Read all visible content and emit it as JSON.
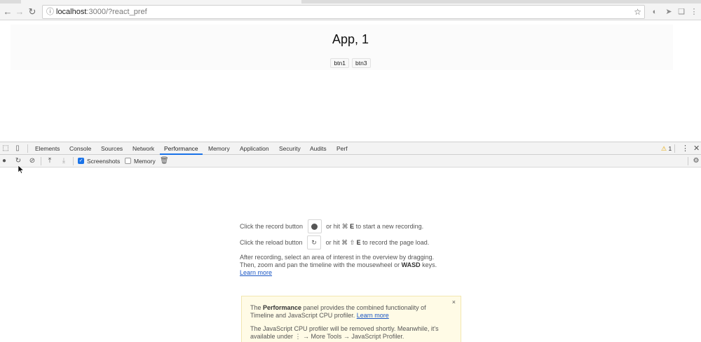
{
  "browser": {
    "url_host": "localhost",
    "url_rest": ":3000/?react_pref",
    "icons": [
      "back-icon",
      "forward-icon",
      "reload-icon",
      "info-icon",
      "star-icon"
    ]
  },
  "page": {
    "title": "App, 1",
    "buttons": [
      "btn1",
      "btn3"
    ]
  },
  "devtools": {
    "tabs": [
      "Elements",
      "Console",
      "Sources",
      "Network",
      "Performance",
      "Memory",
      "Application",
      "Security",
      "Audits",
      "Perf"
    ],
    "active_tab": "Performance",
    "warning_count": "1",
    "toolbar": {
      "screenshots_label": "Screenshots",
      "screenshots_checked": true,
      "memory_label": "Memory",
      "memory_checked": false
    },
    "landing": {
      "record_prefix": "Click the record button",
      "record_suffix_pre": "or hit ⌘ ",
      "record_key": "E",
      "record_suffix_post": " to start a new recording.",
      "reload_prefix": "Click the reload button",
      "reload_suffix_pre": "or hit ⌘ ⇧ ",
      "reload_key": "E",
      "reload_suffix_post": " to record the page load.",
      "after_line1": "After recording, select an area of interest in the overview by dragging.",
      "after_line2_pre": "Then, zoom and pan the timeline with the mousewheel or ",
      "after_line2_key": "WASD",
      "after_line2_post": " keys.",
      "learn_more": "Learn more"
    },
    "banner": {
      "p1_pre": "The ",
      "p1_bold": "Performance",
      "p1_post": " panel provides the combined functionality of Timeline and JavaScript CPU profiler. ",
      "p1_link": "Learn more",
      "p2_line1": "The JavaScript CPU profiler will be removed shortly. Meanwhile, it's",
      "p2_line2": "available under ⋮ → More Tools → JavaScript Profiler.",
      "close": "×"
    }
  }
}
